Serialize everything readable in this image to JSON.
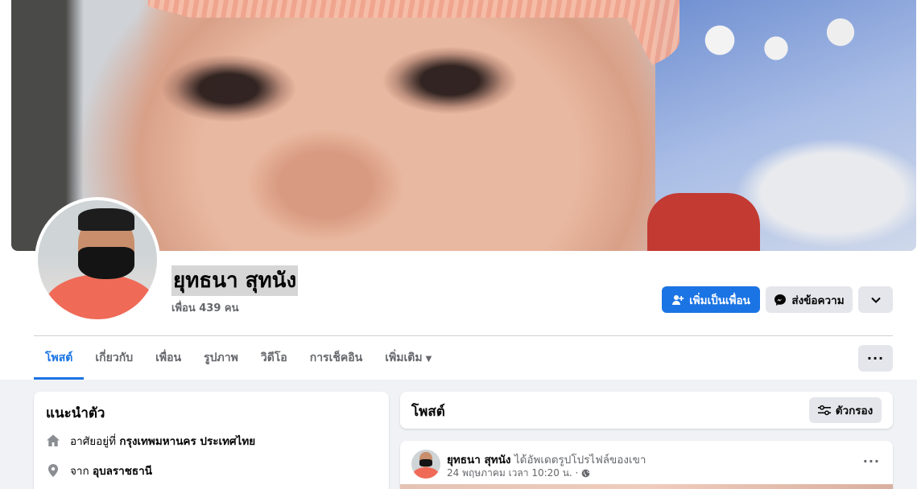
{
  "profile": {
    "name": "ยุทธนา สุทนัง",
    "friends": "เพื่อน 439 คน"
  },
  "actions": {
    "add_friend": "เพิ่มเป็นเพื่อน",
    "message": "ส่งข้อความ"
  },
  "tabs": [
    {
      "label": "โพสต์",
      "active": true
    },
    {
      "label": "เกี่ยวกับ",
      "active": false
    },
    {
      "label": "เพื่อน",
      "active": false
    },
    {
      "label": "รูปภาพ",
      "active": false
    },
    {
      "label": "วิดีโอ",
      "active": false
    },
    {
      "label": "การเช็คอิน",
      "active": false
    },
    {
      "label": "เพิ่มเติม",
      "active": false
    }
  ],
  "intro": {
    "title": "แนะนำตัว",
    "lives_prefix": "อาศัยอยู่ที่",
    "lives_value": "กรุงเทพมหานคร ประเทศไทย",
    "from_prefix": "จาก",
    "from_value": "อุบลราชธานี"
  },
  "posts_section": {
    "title": "โพสต์",
    "filter_label": "ตัวกรอง"
  },
  "post": {
    "author": "ยุทธนา สุทนัง",
    "action": "ได้อัพเดตรูปโปรไฟล์ของเขา",
    "timestamp": "24 พฤษภาคม เวลา 10:20 น. ·"
  },
  "colors": {
    "accent": "#1b74e4",
    "button_gray": "#e4e6eb",
    "page_bg": "#f0f2f5"
  }
}
